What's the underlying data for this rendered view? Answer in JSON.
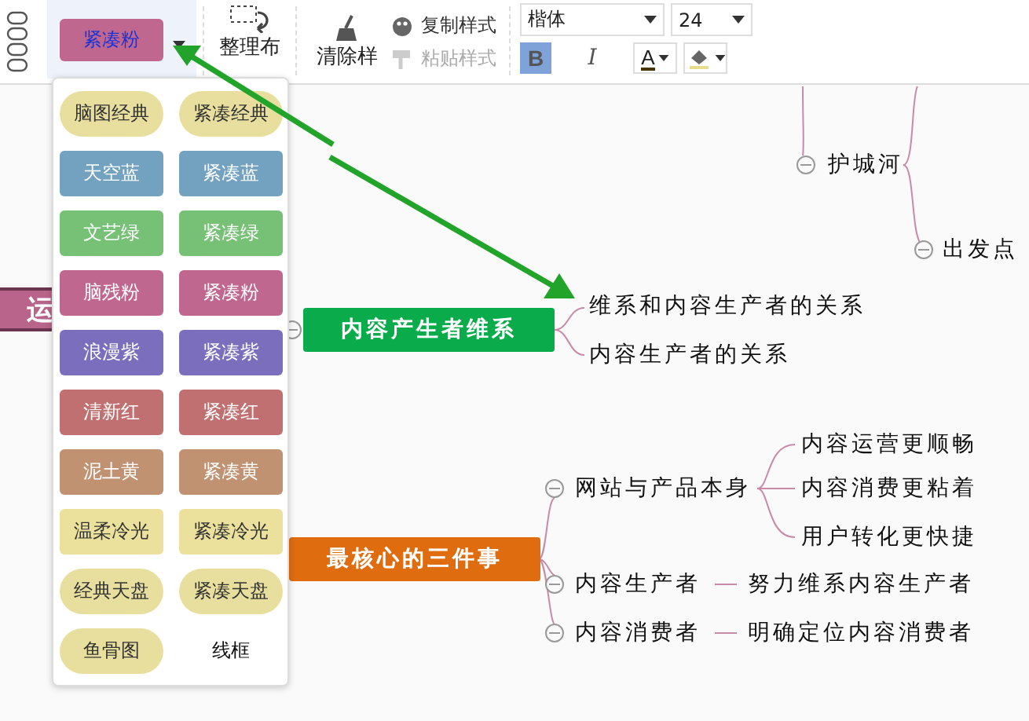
{
  "toolbar": {
    "theme_picker": {
      "label": "紧凑粉",
      "color": "#c0678f",
      "open": true
    },
    "arrange": {
      "label": "整理布"
    },
    "clear_style": {
      "label": "清除样"
    },
    "copy_style": {
      "label": "复制样式",
      "disabled": false
    },
    "paste_style": {
      "label": "粘贴样式",
      "disabled": true
    },
    "font": {
      "value": "楷体"
    },
    "font_size": {
      "value": "24"
    },
    "bold": {
      "label": "B",
      "selected": true
    },
    "italic": {
      "label": "I",
      "selected": false
    },
    "font_color": {
      "label": "A"
    }
  },
  "theme_menu": [
    {
      "label": "脑图经典",
      "color": "#e8df9e",
      "kind": "pill"
    },
    {
      "label": "紧凑经典",
      "color": "#e8df9e",
      "kind": "pill"
    },
    {
      "label": "天空蓝",
      "color": "#73a1c0",
      "kind": "rect"
    },
    {
      "label": "紧凑蓝",
      "color": "#73a1c0",
      "kind": "rect"
    },
    {
      "label": "文艺绿",
      "color": "#77c177",
      "kind": "rect"
    },
    {
      "label": "紧凑绿",
      "color": "#77c177",
      "kind": "rect"
    },
    {
      "label": "脑残粉",
      "color": "#c0678f",
      "kind": "rect"
    },
    {
      "label": "紧凑粉",
      "color": "#c0678f",
      "kind": "rect"
    },
    {
      "label": "浪漫紫",
      "color": "#7b6fbd",
      "kind": "rect"
    },
    {
      "label": "紧凑紫",
      "color": "#7b6fbd",
      "kind": "rect"
    },
    {
      "label": "清新红",
      "color": "#c07070",
      "kind": "rect"
    },
    {
      "label": "紧凑红",
      "color": "#c07070",
      "kind": "rect"
    },
    {
      "label": "泥土黄",
      "color": "#c09272",
      "kind": "rect"
    },
    {
      "label": "紧凑黄",
      "color": "#c09272",
      "kind": "rect"
    },
    {
      "label": "温柔冷光",
      "color": "#ebe09c",
      "kind": "rect"
    },
    {
      "label": "紧凑冷光",
      "color": "#ebe09c",
      "kind": "rect"
    },
    {
      "label": "经典天盘",
      "color": "#e8df9e",
      "kind": "pill"
    },
    {
      "label": "紧凑天盘",
      "color": "#e8df9e",
      "kind": "pill"
    },
    {
      "label": "鱼骨图",
      "color": "#e8df9e",
      "kind": "pill"
    },
    {
      "label": "线框",
      "kind": "plain"
    }
  ],
  "mind_map": {
    "root": {
      "label": "运",
      "color": "#b9648a"
    },
    "upper": {
      "label": "护城河",
      "children": [
        {
          "label": "出发点"
        }
      ]
    },
    "branches": [
      {
        "label": "内容产生者维系",
        "color": "#0aab4b",
        "children": [
          {
            "label": "维系和内容生产者的关系"
          },
          {
            "label": "内容生产者的关系"
          }
        ]
      },
      {
        "label": "最核心的三件事",
        "color": "#e06c10",
        "children": [
          {
            "label": "网站与产品本身",
            "children": [
              {
                "label": "内容运营更顺畅"
              },
              {
                "label": "内容消费更粘着"
              },
              {
                "label": "用户转化更快捷"
              }
            ]
          },
          {
            "label": "内容生产者",
            "children": [
              {
                "label": "努力维系内容生产者"
              }
            ]
          },
          {
            "label": "内容消费者",
            "children": [
              {
                "label": "明确定位内容消费者"
              }
            ]
          }
        ]
      }
    ]
  }
}
